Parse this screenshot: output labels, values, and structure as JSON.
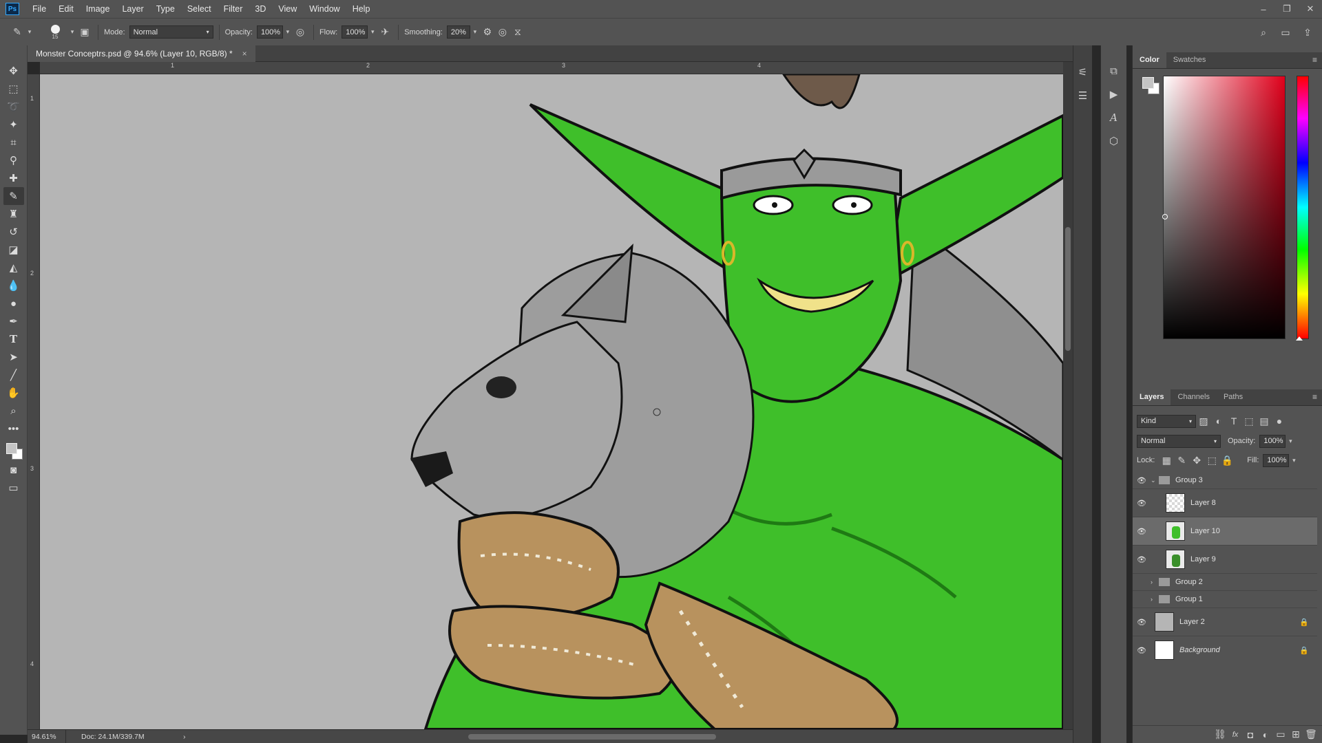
{
  "app": {
    "logo": "Ps"
  },
  "menu": [
    "File",
    "Edit",
    "Image",
    "Layer",
    "Type",
    "Select",
    "Filter",
    "3D",
    "View",
    "Window",
    "Help"
  ],
  "window_controls": {
    "minimize": "–",
    "restore": "❐",
    "close": "✕"
  },
  "options": {
    "brush_size": "15",
    "mode_label": "Mode:",
    "mode_value": "Normal",
    "opacity_label": "Opacity:",
    "opacity_value": "100%",
    "flow_label": "Flow:",
    "flow_value": "100%",
    "smoothing_label": "Smoothing:",
    "smoothing_value": "20%"
  },
  "document": {
    "tab_title": "Monster Conceptrs.psd @ 94.6% (Layer 10, RGB/8) *",
    "close": "×"
  },
  "rulers": {
    "h_marks": [
      "1",
      "2",
      "3",
      "4"
    ],
    "v_marks": [
      "1",
      "2",
      "3",
      "4"
    ]
  },
  "status": {
    "zoom": "94.61%",
    "doc_size": "Doc: 24.1M/339.7M",
    "arrow": "›"
  },
  "color_panel": {
    "tabs": [
      "Color",
      "Swatches"
    ],
    "active_tab": "Color",
    "foreground": "#c4c4c4",
    "background": "#ffffff"
  },
  "layers_panel": {
    "tabs": [
      "Layers",
      "Channels",
      "Paths"
    ],
    "active_tab": "Layers",
    "filter_label": "Kind",
    "blend_mode": "Normal",
    "opacity_label": "Opacity:",
    "opacity_value": "100%",
    "lock_label": "Lock:",
    "fill_label": "Fill:",
    "fill_value": "100%",
    "layers": [
      {
        "name": "Group 3",
        "type": "group",
        "visible": true,
        "expanded": true
      },
      {
        "name": "Layer 8",
        "type": "layer",
        "visible": true
      },
      {
        "name": "Layer 10",
        "type": "layer",
        "visible": true,
        "selected": true
      },
      {
        "name": "Layer 9",
        "type": "layer",
        "visible": true
      },
      {
        "name": "Group 2",
        "type": "group",
        "visible": false
      },
      {
        "name": "Group 1",
        "type": "group",
        "visible": false
      },
      {
        "name": "Layer 2",
        "type": "layer",
        "visible": true,
        "locked": true
      },
      {
        "name": "Background",
        "type": "layer",
        "visible": true,
        "locked": true
      }
    ]
  },
  "colors": {
    "ui_dark": "#282828",
    "ui_panel": "#535353",
    "canvas_bg": "#b5b5b5",
    "goblin_green": "#3fbf2a",
    "wolf_grey": "#9a9a9a",
    "leather": "#b8925e"
  }
}
